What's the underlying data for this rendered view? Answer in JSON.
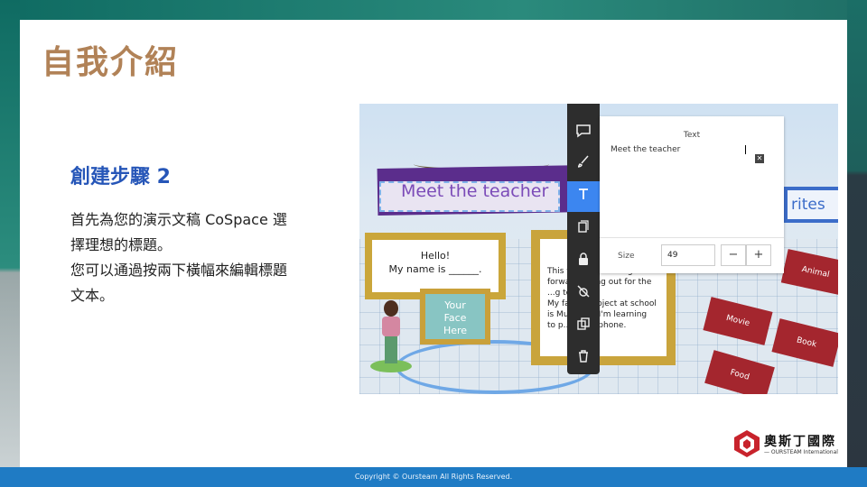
{
  "slide": {
    "title": "自我介紹",
    "subtitle": "創建步驟 2",
    "body_lines": [
      "首先為您的演示文稿 CoSpace 選",
      "擇理想的標題。",
      "您可以通過按兩下橫幅來編輯標題",
      "文本。"
    ],
    "footer": "Copyright © Oursteam All Rights Reserved."
  },
  "screenshot": {
    "banner_text": "Meet the teacher",
    "hello_card": {
      "line1": "Hello!",
      "line2": "My name is ______."
    },
    "face_card": {
      "line1": "Your",
      "line2": "Face",
      "line3": "Here"
    },
    "bio_card": {
      "lines": [
        "This y...   ...ost looking",
        "forwa...   ...ning out for the",
        "...g team.",
        "My fav... ...ubject at school",
        "is Mus... ...e I'm learning",
        "to p... ...xylophone."
      ]
    },
    "favorites_label": "rites",
    "category_cards": [
      "Animal",
      "Movie",
      "Book",
      "Food"
    ],
    "text_panel": {
      "title": "Text",
      "input_value": "Meet the teacher",
      "size_label": "Size",
      "size_value": "49",
      "minus": "−",
      "plus": "+",
      "close": "✕"
    },
    "toolbar_icons": [
      "comment-icon",
      "brush-icon",
      "text-icon",
      "layers-icon",
      "lock-icon",
      "no-physics-icon",
      "duplicate-icon",
      "trash-icon"
    ]
  },
  "logo": {
    "cn": "奧斯丁國際",
    "en": "— OURSTEAM International"
  },
  "colors": {
    "title": "#b18257",
    "subtitle": "#2656b8",
    "footer": "#1f7bc4",
    "toolbar_active": "#3c86f0"
  }
}
